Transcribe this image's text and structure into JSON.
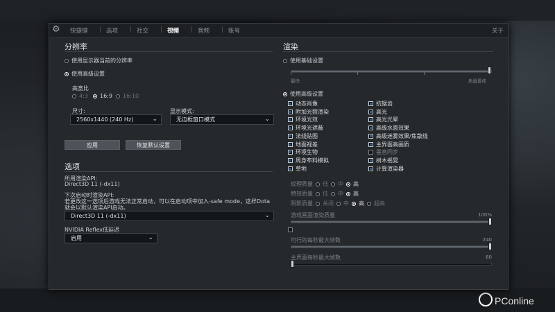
{
  "nav": {
    "tabs": [
      "快捷键",
      "选项",
      "社交",
      "视频",
      "音频",
      "账号"
    ],
    "active_index": 3,
    "close_label": "关于"
  },
  "resolution": {
    "title": "分辨率",
    "use_display_res": "使用显示器当前的分辨率",
    "use_advanced": "使用高级设置",
    "aspect_label": "高宽比",
    "aspects": [
      "4:3",
      "16:9",
      "16:10"
    ],
    "aspect_selected": "16:9",
    "size_label": "尺寸:",
    "size_value": "2560x1440 (240 Hz)",
    "display_mode_label": "显示模式:",
    "display_mode_value": "无边框窗口模式",
    "apply_label": "应用",
    "reset_label": "恢复默认设置"
  },
  "options": {
    "title": "选项",
    "render_api_label": "所用渲染API:",
    "render_api_value": "Direct3D 11 (-dx11)",
    "next_api_label": "下次启动时渲染API:",
    "next_api_note_1": "若更改这一选项后游戏无法正常启动，可以在启动项中加入-safe mode，这样Dota",
    "next_api_note_2": "就会以默认渲染API启动。",
    "next_api_value": "Direct3D 11 (-dx11)",
    "reflex_label": "NVIDIA Reflex低延迟",
    "reflex_value": "启用"
  },
  "render": {
    "title": "渲染",
    "use_basic": "使用基础设置",
    "basic_left": "最快",
    "basic_right": "质量最佳",
    "use_advanced": "使用高级设置",
    "left_checks": [
      {
        "label": "动态肖像",
        "on": true
      },
      {
        "label": "附加光照渲染",
        "on": true
      },
      {
        "label": "环境光效",
        "on": true
      },
      {
        "label": "环境光遮蔽",
        "on": true
      },
      {
        "label": "法线贴图",
        "on": true
      },
      {
        "label": "地面视差",
        "on": true
      },
      {
        "label": "环境生物",
        "on": true
      },
      {
        "label": "周身布料模拟",
        "on": true
      },
      {
        "label": "草地",
        "on": true
      }
    ],
    "right_checks": [
      {
        "label": "抗锯齿",
        "on": true
      },
      {
        "label": "高光",
        "on": true
      },
      {
        "label": "高光光晕",
        "on": true
      },
      {
        "label": "高级水面效果",
        "on": true
      },
      {
        "label": "高级迷雾效果/焦散线",
        "on": true
      },
      {
        "label": "主界面高画质",
        "on": true
      },
      {
        "label": "垂直同步",
        "on": false
      },
      {
        "label": "树木摇晃",
        "on": true
      },
      {
        "label": "计算渲染器",
        "on": true
      }
    ],
    "texture_label": "纹理质量",
    "effects_label": "特效质量",
    "shadow_label": "阴影质量",
    "low": "低",
    "mid": "中",
    "high": "高",
    "off": "关闭",
    "ultra": "超高",
    "texture_selected": "高",
    "effects_selected": "高",
    "shadow_selected": "高",
    "screen_quality_label": "游戏画面渲染质量",
    "screen_quality_value": "100%",
    "screen_quality_level": 1.0,
    "fps_label": "可行的每秒最大帧数",
    "fps_value": "240",
    "fps_level": 1.0,
    "menu_fps_label": "主界面每秒最大帧数",
    "menu_fps_value": "60",
    "menu_fps_level": 0.0
  },
  "watermark": "PConline",
  "colors": {
    "accent": "#2e5a8a",
    "panel": "#25292c"
  }
}
